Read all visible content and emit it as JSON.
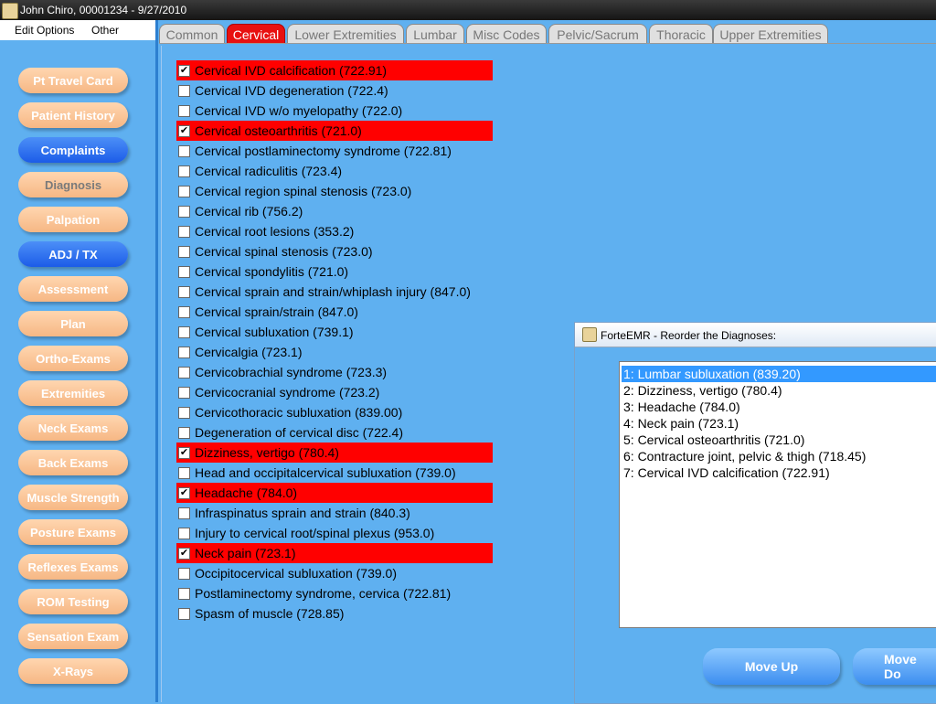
{
  "window": {
    "title": "John Chiro, 00001234 - 9/27/2010",
    "icon": "app-icon"
  },
  "menu": [
    {
      "label": "Edit Options"
    },
    {
      "label": "Other"
    }
  ],
  "sidebar": {
    "items": [
      {
        "label": "Pt Travel Card",
        "state": "normal"
      },
      {
        "label": "Patient History",
        "state": "normal"
      },
      {
        "label": "Complaints",
        "state": "active"
      },
      {
        "label": "Diagnosis",
        "state": "grey"
      },
      {
        "label": "Palpation",
        "state": "normal"
      },
      {
        "label": "ADJ / TX",
        "state": "active"
      },
      {
        "label": "Assessment",
        "state": "normal"
      },
      {
        "label": "Plan",
        "state": "normal"
      },
      {
        "label": "Ortho-Exams",
        "state": "normal"
      },
      {
        "label": "Extremities",
        "state": "normal"
      },
      {
        "label": "Neck Exams",
        "state": "normal"
      },
      {
        "label": "Back Exams",
        "state": "normal"
      },
      {
        "label": "Muscle Strength",
        "state": "normal"
      },
      {
        "label": "Posture Exams",
        "state": "normal"
      },
      {
        "label": "Reflexes Exams",
        "state": "normal"
      },
      {
        "label": "ROM Testing",
        "state": "normal"
      },
      {
        "label": "Sensation Exam",
        "state": "normal"
      },
      {
        "label": "X-Rays",
        "state": "normal"
      }
    ]
  },
  "tabs": [
    {
      "label": "Common",
      "active": false
    },
    {
      "label": "Cervical",
      "active": true
    },
    {
      "label": "Lower Extremities",
      "active": false
    },
    {
      "label": "Lumbar",
      "active": false
    },
    {
      "label": "Misc Codes",
      "active": false
    },
    {
      "label": "Pelvic/Sacrum",
      "active": false
    },
    {
      "label": "Thoracic",
      "active": false
    },
    {
      "label": "Upper Extremities",
      "active": false
    }
  ],
  "diagnoses": [
    {
      "label": "Cervical IVD calcification (722.91)",
      "checked": true
    },
    {
      "label": "Cervical IVD degeneration (722.4)",
      "checked": false
    },
    {
      "label": "Cervical IVD w/o myelopathy (722.0)",
      "checked": false
    },
    {
      "label": "Cervical osteoarthritis (721.0)",
      "checked": true
    },
    {
      "label": "Cervical postlaminectomy syndrome (722.81)",
      "checked": false
    },
    {
      "label": "Cervical radiculitis (723.4)",
      "checked": false
    },
    {
      "label": "Cervical region spinal stenosis (723.0)",
      "checked": false
    },
    {
      "label": "Cervical rib (756.2)",
      "checked": false
    },
    {
      "label": "Cervical root lesions (353.2)",
      "checked": false
    },
    {
      "label": "Cervical spinal stenosis (723.0)",
      "checked": false
    },
    {
      "label": "Cervical spondylitis (721.0)",
      "checked": false
    },
    {
      "label": "Cervical sprain and strain/whiplash injury (847.0)",
      "checked": false
    },
    {
      "label": "Cervical sprain/strain (847.0)",
      "checked": false
    },
    {
      "label": "Cervical subluxation (739.1)",
      "checked": false
    },
    {
      "label": "Cervicalgia (723.1)",
      "checked": false
    },
    {
      "label": "Cervicobrachial syndrome (723.3)",
      "checked": false
    },
    {
      "label": "Cervicocranial syndrome (723.2)",
      "checked": false
    },
    {
      "label": "Cervicothoracic subluxation (839.00)",
      "checked": false
    },
    {
      "label": "Degeneration of cervical disc (722.4)",
      "checked": false
    },
    {
      "label": "Dizziness, vertigo (780.4)",
      "checked": true
    },
    {
      "label": "Head and occipitalcervical subluxation (739.0)",
      "checked": false
    },
    {
      "label": "Headache (784.0)",
      "checked": true
    },
    {
      "label": "Infraspinatus sprain and strain (840.3)",
      "checked": false
    },
    {
      "label": "Injury to cervical root/spinal plexus (953.0)",
      "checked": false
    },
    {
      "label": "Neck pain (723.1)",
      "checked": true
    },
    {
      "label": "Occipitocervical subluxation (739.0)",
      "checked": false
    },
    {
      "label": "Postlaminectomy syndrome, cervica (722.81)",
      "checked": false
    },
    {
      "label": "Spasm of muscle (728.85)",
      "checked": false
    }
  ],
  "dialog": {
    "title": "ForteEMR - Reorder the Diagnoses:",
    "items": [
      {
        "label": "1: Lumbar subluxation (839.20)",
        "selected": true
      },
      {
        "label": "2: Dizziness, vertigo (780.4)",
        "selected": false
      },
      {
        "label": "3: Headache (784.0)",
        "selected": false
      },
      {
        "label": "4: Neck pain (723.1)",
        "selected": false
      },
      {
        "label": "5: Cervical osteoarthritis (721.0)",
        "selected": false
      },
      {
        "label": "6: Contracture joint, pelvic & thigh (718.45)",
        "selected": false
      },
      {
        "label": "7: Cervical IVD calcification (722.91)",
        "selected": false
      }
    ],
    "move_up_label": "Move Up",
    "move_down_label": "Move Do"
  }
}
